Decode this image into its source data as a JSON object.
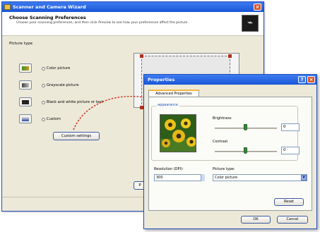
{
  "wizard": {
    "title": "Scanner and Camera Wizard",
    "header_title": "Choose Scanning Preferences",
    "header_text": "Choose your scanning preferences, and then click Preview to see how your preferences affect the picture.",
    "section_label": "Picture type",
    "options": [
      {
        "label": "Color picture",
        "selected": false
      },
      {
        "label": "Grayscale picture",
        "selected": false
      },
      {
        "label": "Black and white picture or text",
        "selected": false
      },
      {
        "label": "Custom",
        "selected": false
      }
    ],
    "custom_button": "Custom settings",
    "preview_button": "P",
    "close_glyph": "×"
  },
  "properties": {
    "title": "Properties",
    "help_glyph": "?",
    "close_glyph": "×",
    "tab": "Advanced Properties",
    "appearance_label": "Appearance",
    "brightness": {
      "label": "Brightness",
      "value": "0",
      "level": 0.5
    },
    "contrast": {
      "label": "Contrast",
      "value": "0",
      "level": 0.5
    },
    "resolution": {
      "label": "Resolution (DPI):",
      "value": "300"
    },
    "picture_type": {
      "label": "Picture type:",
      "value": "Color picture"
    },
    "reset_button": "Reset",
    "ok_button": "OK",
    "cancel_button": "Cancel"
  },
  "colors": {
    "titlebar": "#1a56d8",
    "accent": "#d6532a",
    "arrow": "#cc2a1a"
  }
}
